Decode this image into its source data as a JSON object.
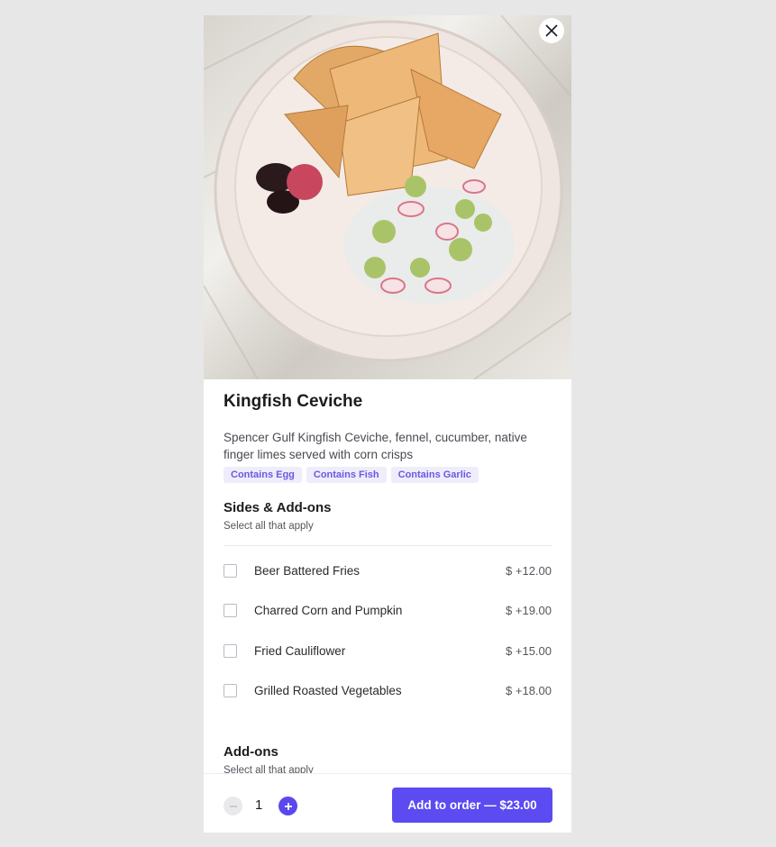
{
  "item": {
    "title": "Kingfish Ceviche",
    "description": "Spencer Gulf Kingfish Ceviche, fennel, cucumber, native finger limes served with corn crisps",
    "tags": [
      "Contains Egg",
      "Contains Fish",
      "Contains Garlic"
    ]
  },
  "sides": {
    "title": "Sides & Add-ons",
    "subtitle": "Select all that apply",
    "options": [
      {
        "label": "Beer Battered Fries",
        "price": "$ +12.00"
      },
      {
        "label": "Charred Corn and Pumpkin",
        "price": "$ +19.00"
      },
      {
        "label": "Fried Cauliflower",
        "price": "$ +15.00"
      },
      {
        "label": "Grilled Roasted Vegetables",
        "price": "$ +18.00"
      }
    ]
  },
  "addons": {
    "title": "Add-ons",
    "subtitle": "Select all that apply"
  },
  "footer": {
    "quantity": "1",
    "add_label": "Add to order — $23.00"
  },
  "icons": {
    "close": "close-icon",
    "minus": "minus-icon",
    "plus": "plus-icon"
  },
  "colors": {
    "accent": "#5b4bf0",
    "tag_bg": "#efedfb",
    "tag_text": "#6a5ae0"
  }
}
